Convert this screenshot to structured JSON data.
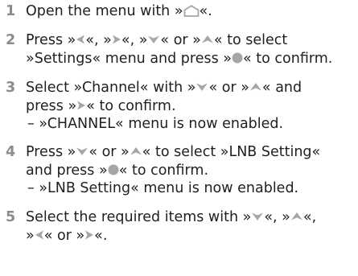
{
  "colors": {
    "text": "#1f1f1f",
    "step_number": "#8c8c8c",
    "button_glyph": "#a6a6a6"
  },
  "icons": {
    "home": "home-outline-icon",
    "left": "arrow-left-icon",
    "right": "arrow-right-icon",
    "down": "arrow-down-icon",
    "up": "arrow-up-icon",
    "ok": "ok-dot-icon"
  },
  "steps": [
    {
      "number": "1",
      "l1a": "Open the menu with »",
      "l1b": "«."
    },
    {
      "number": "2",
      "l1a": "Press »",
      "l1b": "«, »",
      "l1c": "«, »",
      "l1d": "« or »",
      "l1e": "« to select",
      "l2a": "»Settings« menu and press »",
      "l2b": "« to confirm."
    },
    {
      "number": "3",
      "l1a": "Select »Channel« with »",
      "l1b": "« or »",
      "l1c": "« and",
      "l2a": "press »",
      "l2b": "« to confirm.",
      "sub": "– »CHANNEL« menu is now enabled."
    },
    {
      "number": "4",
      "l1a": "Press »",
      "l1b": "« or »",
      "l1c": "« to select »LNB Setting«",
      "l2a": "and press »",
      "l2b": "« to confirm.",
      "sub": "– »LNB Setting« menu is now enabled."
    },
    {
      "number": "5",
      "l1a": "Select the required items with »",
      "l1b": "«, »",
      "l1c": "«,",
      "l2a": "»",
      "l2b": "« or »",
      "l2c": "«."
    }
  ]
}
